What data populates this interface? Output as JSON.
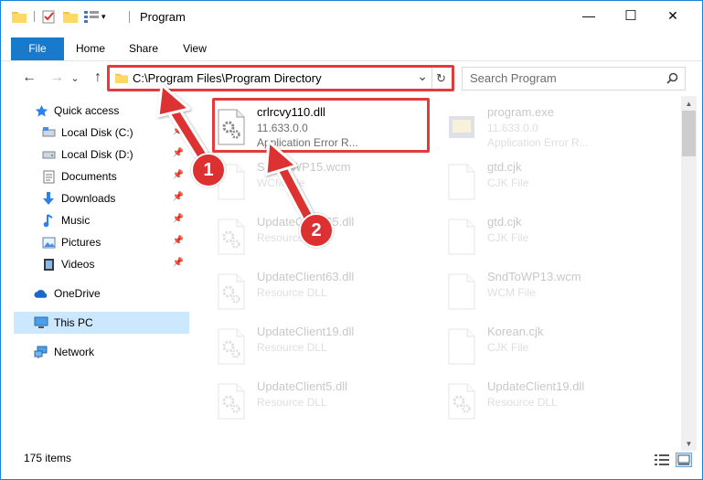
{
  "window": {
    "title": "Program",
    "controls": {
      "minimize": "—",
      "maximize": "☐",
      "close": "✕"
    }
  },
  "ribbon": {
    "tabs": [
      {
        "label": "File",
        "active": true
      },
      {
        "label": "Home"
      },
      {
        "label": "Share"
      },
      {
        "label": "View"
      }
    ]
  },
  "address": {
    "path": "C:\\Program Files\\Program Directory",
    "dropdown": "⌄",
    "refresh": "↻"
  },
  "nav": {
    "back": "←",
    "forward": "→",
    "recent": "⌄",
    "up": "↑"
  },
  "search": {
    "placeholder": "Search Program",
    "icon": "search-icon"
  },
  "sidebar": {
    "items": [
      {
        "label": "Quick access",
        "icon": "star-icon"
      },
      {
        "label": "Local Disk (C:)",
        "icon": "drive-icon",
        "pinned": true
      },
      {
        "label": "Local Disk (D:)",
        "icon": "drive-icon",
        "pinned": true
      },
      {
        "label": "Documents",
        "icon": "documents-icon",
        "pinned": true
      },
      {
        "label": "Downloads",
        "icon": "download-icon",
        "pinned": true
      },
      {
        "label": "Music",
        "icon": "music-icon",
        "pinned": true
      },
      {
        "label": "Pictures",
        "icon": "pictures-icon",
        "pinned": true
      },
      {
        "label": "Videos",
        "icon": "video-icon",
        "pinned": true
      },
      {
        "label": "OneDrive",
        "icon": "cloud-icon"
      },
      {
        "label": "This PC",
        "icon": "computer-icon",
        "selected": true
      },
      {
        "label": "Network",
        "icon": "network-icon"
      }
    ]
  },
  "files": [
    {
      "name": "crlrcvy110.dll",
      "line1": "11.633.0.0",
      "line2": "Application Error R...",
      "highlighted": true
    },
    {
      "name": "program.exe",
      "line1": "11.633.0.0",
      "line2": "Application Error R..."
    },
    {
      "name": "SndToWP15.wcm",
      "line1": "WCM File",
      "line2": ""
    },
    {
      "name": "gtd.cjk",
      "line1": "CJK File",
      "line2": ""
    },
    {
      "name": "UpdateClient65.dll",
      "line1": "Resource DLL",
      "line2": ""
    },
    {
      "name": "gtd.cjk",
      "line1": "CJK File",
      "line2": ""
    },
    {
      "name": "UpdateClient63.dll",
      "line1": "Resource DLL",
      "line2": ""
    },
    {
      "name": "SndToWP13.wcm",
      "line1": "WCM File",
      "line2": ""
    },
    {
      "name": "UpdateClient19.dll",
      "line1": "Resource DLL",
      "line2": ""
    },
    {
      "name": "Korean.cjk",
      "line1": "CJK File",
      "line2": ""
    },
    {
      "name": "UpdateClient5.dll",
      "line1": "Resource DLL",
      "line2": ""
    },
    {
      "name": "UpdateClient19.dll",
      "line1": "Resource DLL",
      "line2": ""
    }
  ],
  "status": {
    "count": "175 items"
  },
  "annotations": {
    "badge1": "1",
    "badge2": "2",
    "color": "#dd3131"
  }
}
